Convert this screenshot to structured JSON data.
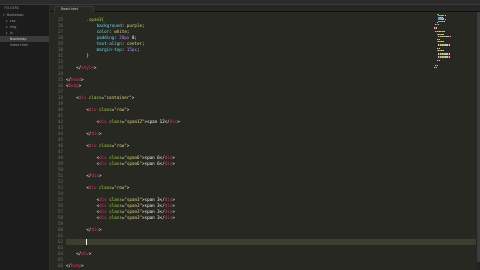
{
  "sidebar": {
    "header": "FOLDERS",
    "items": [
      {
        "label": "Bootstrap",
        "indent": 1,
        "twisty": "▾",
        "selected": false
      },
      {
        "label": "css",
        "indent": 2,
        "twisty": "▸",
        "selected": false
      },
      {
        "label": "img",
        "indent": 2,
        "twisty": "▸",
        "selected": false
      },
      {
        "label": "js",
        "indent": 2,
        "twisty": "▸",
        "selected": false
      },
      {
        "label": "Bootstrap",
        "indent": 2,
        "twisty": "",
        "selected": true
      },
      {
        "label": "index.html",
        "indent": 2,
        "twisty": "",
        "selected": false
      }
    ]
  },
  "tabs": [
    {
      "label": "Read.html",
      "active": true
    }
  ],
  "editor": {
    "lines": [
      {
        "n": "25",
        "indent": 8,
        "tokens": [
          {
            "t": "sel",
            "v": ".span3{"
          }
        ]
      },
      {
        "n": "26",
        "indent": 12,
        "tokens": [
          {
            "t": "prop",
            "v": "background"
          },
          {
            "t": "txt",
            "v": ": "
          },
          {
            "t": "str",
            "v": "purple"
          },
          {
            "t": "txt",
            "v": ";"
          }
        ]
      },
      {
        "n": "27",
        "indent": 12,
        "tokens": [
          {
            "t": "prop",
            "v": "color"
          },
          {
            "t": "txt",
            "v": ": "
          },
          {
            "t": "str",
            "v": "white"
          },
          {
            "t": "txt",
            "v": ";"
          }
        ]
      },
      {
        "n": "28",
        "indent": 12,
        "tokens": [
          {
            "t": "prop",
            "v": "padding"
          },
          {
            "t": "txt",
            "v": ": "
          },
          {
            "t": "num",
            "v": "20px"
          },
          {
            "t": "txt",
            "v": " 0;"
          }
        ]
      },
      {
        "n": "29",
        "indent": 12,
        "tokens": [
          {
            "t": "prop",
            "v": "text-align"
          },
          {
            "t": "txt",
            "v": ": "
          },
          {
            "t": "str",
            "v": "center"
          },
          {
            "t": "txt",
            "v": ";"
          }
        ]
      },
      {
        "n": "30",
        "indent": 12,
        "tokens": [
          {
            "t": "prop",
            "v": "margin-top"
          },
          {
            "t": "txt",
            "v": ": "
          },
          {
            "t": "num",
            "v": "15px"
          },
          {
            "t": "txt",
            "v": ";"
          }
        ]
      },
      {
        "n": "31",
        "indent": 8,
        "tokens": [
          {
            "t": "txt",
            "v": "}"
          }
        ]
      },
      {
        "n": "32",
        "indent": 0,
        "tokens": []
      },
      {
        "n": "33",
        "indent": 4,
        "tokens": [
          {
            "t": "txt",
            "v": "</"
          },
          {
            "t": "tag",
            "v": "style"
          },
          {
            "t": "txt",
            "v": ">"
          }
        ]
      },
      {
        "n": "34",
        "indent": 0,
        "tokens": []
      },
      {
        "n": "35",
        "indent": 0,
        "tokens": [
          {
            "t": "txt",
            "v": "</"
          },
          {
            "t": "tag",
            "v": "head"
          },
          {
            "t": "txt",
            "v": ">"
          }
        ]
      },
      {
        "n": "36",
        "indent": 0,
        "tokens": [
          {
            "t": "txt",
            "v": "<"
          },
          {
            "t": "tag",
            "v": "body"
          },
          {
            "t": "txt",
            "v": ">"
          }
        ]
      },
      {
        "n": "37",
        "indent": 0,
        "tokens": []
      },
      {
        "n": "38",
        "indent": 4,
        "tokens": [
          {
            "t": "txt",
            "v": "<"
          },
          {
            "t": "tag",
            "v": "div"
          },
          {
            "t": "txt",
            "v": " "
          },
          {
            "t": "attr",
            "v": "class"
          },
          {
            "t": "txt",
            "v": "="
          },
          {
            "t": "str",
            "v": "\"container\""
          },
          {
            "t": "txt",
            "v": ">"
          }
        ]
      },
      {
        "n": "39",
        "indent": 0,
        "tokens": []
      },
      {
        "n": "40",
        "indent": 8,
        "tokens": [
          {
            "t": "txt",
            "v": "<"
          },
          {
            "t": "tag",
            "v": "div"
          },
          {
            "t": "txt",
            "v": " "
          },
          {
            "t": "attr",
            "v": "class"
          },
          {
            "t": "txt",
            "v": "="
          },
          {
            "t": "str",
            "v": "\"row\""
          },
          {
            "t": "txt",
            "v": ">"
          }
        ]
      },
      {
        "n": "41",
        "indent": 0,
        "tokens": []
      },
      {
        "n": "42",
        "indent": 12,
        "tokens": [
          {
            "t": "txt",
            "v": "<"
          },
          {
            "t": "tag",
            "v": "div"
          },
          {
            "t": "txt",
            "v": " "
          },
          {
            "t": "attr",
            "v": "class"
          },
          {
            "t": "txt",
            "v": "="
          },
          {
            "t": "str",
            "v": "\"span12\""
          },
          {
            "t": "txt",
            "v": ">span 12</"
          },
          {
            "t": "tag",
            "v": "div"
          },
          {
            "t": "txt",
            "v": ">"
          }
        ]
      },
      {
        "n": "43",
        "indent": 0,
        "tokens": []
      },
      {
        "n": "44",
        "indent": 8,
        "tokens": [
          {
            "t": "txt",
            "v": "</"
          },
          {
            "t": "tag",
            "v": "div"
          },
          {
            "t": "txt",
            "v": ">"
          }
        ]
      },
      {
        "n": "45",
        "indent": 0,
        "tokens": []
      },
      {
        "n": "46",
        "indent": 8,
        "tokens": [
          {
            "t": "txt",
            "v": "<"
          },
          {
            "t": "tag",
            "v": "div"
          },
          {
            "t": "txt",
            "v": " "
          },
          {
            "t": "attr",
            "v": "class"
          },
          {
            "t": "txt",
            "v": "="
          },
          {
            "t": "str",
            "v": "\"row\""
          },
          {
            "t": "txt",
            "v": ">"
          }
        ]
      },
      {
        "n": "47",
        "indent": 0,
        "tokens": []
      },
      {
        "n": "48",
        "indent": 12,
        "tokens": [
          {
            "t": "txt",
            "v": "<"
          },
          {
            "t": "tag",
            "v": "div"
          },
          {
            "t": "txt",
            "v": " "
          },
          {
            "t": "attr",
            "v": "class"
          },
          {
            "t": "txt",
            "v": "="
          },
          {
            "t": "str",
            "v": "\"span6\""
          },
          {
            "t": "txt",
            "v": ">span 6</"
          },
          {
            "t": "tag",
            "v": "div"
          },
          {
            "t": "txt",
            "v": ">"
          }
        ]
      },
      {
        "n": "49",
        "indent": 12,
        "tokens": [
          {
            "t": "txt",
            "v": "<"
          },
          {
            "t": "tag",
            "v": "div"
          },
          {
            "t": "txt",
            "v": " "
          },
          {
            "t": "attr",
            "v": "class"
          },
          {
            "t": "txt",
            "v": "="
          },
          {
            "t": "str",
            "v": "\"span6\""
          },
          {
            "t": "txt",
            "v": ">span 6</"
          },
          {
            "t": "tag",
            "v": "div"
          },
          {
            "t": "txt",
            "v": ">"
          }
        ]
      },
      {
        "n": "50",
        "indent": 0,
        "tokens": []
      },
      {
        "n": "51",
        "indent": 8,
        "tokens": [
          {
            "t": "txt",
            "v": "</"
          },
          {
            "t": "tag",
            "v": "div"
          },
          {
            "t": "txt",
            "v": ">"
          }
        ]
      },
      {
        "n": "52",
        "indent": 0,
        "tokens": []
      },
      {
        "n": "53",
        "indent": 8,
        "tokens": [
          {
            "t": "txt",
            "v": "<"
          },
          {
            "t": "tag",
            "v": "div"
          },
          {
            "t": "txt",
            "v": " "
          },
          {
            "t": "attr",
            "v": "class"
          },
          {
            "t": "txt",
            "v": "="
          },
          {
            "t": "str",
            "v": "\"row\""
          },
          {
            "t": "txt",
            "v": ">"
          }
        ]
      },
      {
        "n": "54",
        "indent": 0,
        "tokens": []
      },
      {
        "n": "55",
        "indent": 12,
        "tokens": [
          {
            "t": "txt",
            "v": "<"
          },
          {
            "t": "tag",
            "v": "div"
          },
          {
            "t": "txt",
            "v": " "
          },
          {
            "t": "attr",
            "v": "class"
          },
          {
            "t": "txt",
            "v": "="
          },
          {
            "t": "str",
            "v": "\"span3\""
          },
          {
            "t": "txt",
            "v": ">span 3</"
          },
          {
            "t": "tag",
            "v": "div"
          },
          {
            "t": "txt",
            "v": ">"
          }
        ]
      },
      {
        "n": "56",
        "indent": 12,
        "tokens": [
          {
            "t": "txt",
            "v": "<"
          },
          {
            "t": "tag",
            "v": "div"
          },
          {
            "t": "txt",
            "v": " "
          },
          {
            "t": "attr",
            "v": "class"
          },
          {
            "t": "txt",
            "v": "="
          },
          {
            "t": "str",
            "v": "\"span3\""
          },
          {
            "t": "txt",
            "v": ">span 3</"
          },
          {
            "t": "tag",
            "v": "div"
          },
          {
            "t": "txt",
            "v": ">"
          }
        ]
      },
      {
        "n": "57",
        "indent": 12,
        "tokens": [
          {
            "t": "txt",
            "v": "<"
          },
          {
            "t": "tag",
            "v": "div"
          },
          {
            "t": "txt",
            "v": " "
          },
          {
            "t": "attr",
            "v": "class"
          },
          {
            "t": "txt",
            "v": "="
          },
          {
            "t": "str",
            "v": "\"span3\""
          },
          {
            "t": "txt",
            "v": ">span 3</"
          },
          {
            "t": "tag",
            "v": "div"
          },
          {
            "t": "txt",
            "v": ">"
          }
        ]
      },
      {
        "n": "58",
        "indent": 12,
        "tokens": [
          {
            "t": "txt",
            "v": "<"
          },
          {
            "t": "tag",
            "v": "div"
          },
          {
            "t": "txt",
            "v": " "
          },
          {
            "t": "attr",
            "v": "class"
          },
          {
            "t": "txt",
            "v": "="
          },
          {
            "t": "str",
            "v": "\"span3\""
          },
          {
            "t": "txt",
            "v": ">span 3</"
          },
          {
            "t": "tag",
            "v": "div"
          },
          {
            "t": "txt",
            "v": ">"
          }
        ]
      },
      {
        "n": "59",
        "indent": 0,
        "tokens": []
      },
      {
        "n": "60",
        "indent": 8,
        "tokens": [
          {
            "t": "txt",
            "v": "</"
          },
          {
            "t": "tag",
            "v": "div"
          },
          {
            "t": "txt",
            "v": ">"
          }
        ]
      },
      {
        "n": "61",
        "indent": 0,
        "tokens": []
      },
      {
        "n": "62",
        "indent": 8,
        "tokens": [],
        "cursor": true
      },
      {
        "n": "63",
        "indent": 0,
        "tokens": []
      },
      {
        "n": "64",
        "indent": 4,
        "tokens": [
          {
            "t": "txt",
            "v": "</"
          },
          {
            "t": "tag",
            "v": "div"
          },
          {
            "t": "txt",
            "v": ">"
          }
        ]
      },
      {
        "n": "65",
        "indent": 0,
        "tokens": []
      },
      {
        "n": "66",
        "indent": 0,
        "tokens": [
          {
            "t": "txt",
            "v": "</"
          },
          {
            "t": "tag",
            "v": "body"
          },
          {
            "t": "txt",
            "v": ">"
          }
        ]
      }
    ]
  },
  "theme": {
    "background": "#272822",
    "tag": "#f92672",
    "attr": "#a6e22e",
    "string": "#e6db74",
    "number": "#ae81ff",
    "property": "#66d9ef",
    "text": "#f8f8f2"
  }
}
